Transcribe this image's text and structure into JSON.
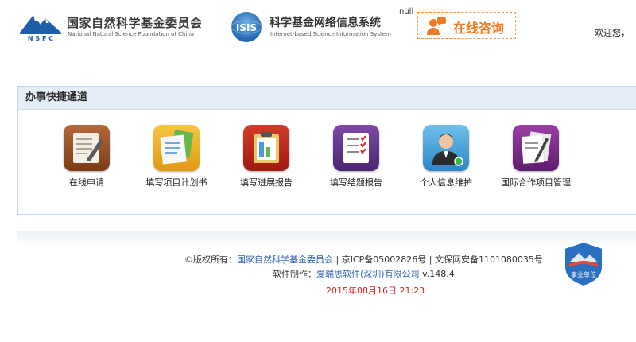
{
  "header": {
    "nsfc_logo_text": "N S F C",
    "nsfc_title": "国家自然科学基金委员会",
    "nsfc_subtitle": "National Natural Science Foundation of China",
    "isis_logo_text": "ISIS",
    "isis_title": "科学基金网络信息系统",
    "isis_subtitle": "Internet-based Science Information System",
    "null_text": "null",
    "consult_label": "在线咨询",
    "welcome": "欢迎您，"
  },
  "panel": {
    "title": "办事快捷通道",
    "shortcuts": [
      {
        "label": "在线申请",
        "icon": "pen-document-icon"
      },
      {
        "label": "填写项目计划书",
        "icon": "plan-document-icon"
      },
      {
        "label": "填写进展报告",
        "icon": "progress-report-icon"
      },
      {
        "label": "填写结题报告",
        "icon": "checklist-report-icon"
      },
      {
        "label": "个人信息维护",
        "icon": "user-profile-icon"
      },
      {
        "label": "国际合作项目管理",
        "icon": "international-docs-icon"
      }
    ]
  },
  "footer": {
    "copyright_prefix": "©版权所有：",
    "copyright_org": "国家自然科学基金委员会",
    "icp": " | 京ICP备05002826号 | 文保网安备1101080035号",
    "software_prefix": "软件制作：",
    "software_company": "爱瑞思软件(深圳)有限公司",
    "version": " v.148.4",
    "datetime": "2015年08月16日 21:23",
    "badge_text": "事业单位"
  },
  "colors": {
    "accent_orange": "#f07a22",
    "link_blue": "#2f63b0",
    "date_red": "#d21f1f",
    "panel_header_bg": "#e6eff7"
  }
}
